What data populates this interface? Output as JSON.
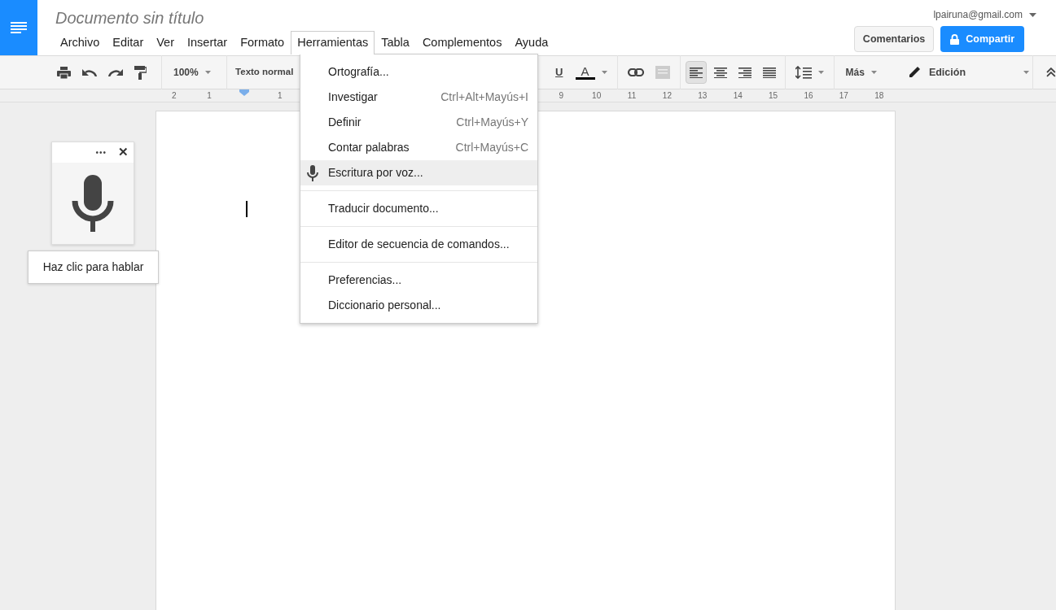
{
  "document": {
    "title": "Documento sin título"
  },
  "account": {
    "email": "lpairuna@gmail.com"
  },
  "menubar": [
    {
      "label": "Archivo",
      "selected": false
    },
    {
      "label": "Editar",
      "selected": false
    },
    {
      "label": "Ver",
      "selected": false
    },
    {
      "label": "Insertar",
      "selected": false
    },
    {
      "label": "Formato",
      "selected": false
    },
    {
      "label": "Herramientas",
      "selected": true
    },
    {
      "label": "Tabla",
      "selected": false
    },
    {
      "label": "Complementos",
      "selected": false
    },
    {
      "label": "Ayuda",
      "selected": false
    }
  ],
  "header_buttons": {
    "comments": "Comentarios",
    "share": "Compartir"
  },
  "toolbar": {
    "zoom": "100%",
    "style": "Texto normal",
    "more": "Más",
    "mode": "Edición",
    "underline": "U",
    "text_color_letter": "A",
    "alignments": [
      {
        "kind": "left",
        "selected": true
      },
      {
        "kind": "center",
        "selected": false
      },
      {
        "kind": "right",
        "selected": false
      },
      {
        "kind": "justify",
        "selected": false
      }
    ]
  },
  "ruler": {
    "left_labels": [
      "2",
      "1",
      "1"
    ],
    "right_labels": [
      "9",
      "10",
      "11",
      "12",
      "13",
      "14",
      "15",
      "16",
      "17",
      "18"
    ]
  },
  "tools_menu": {
    "groups": [
      [
        {
          "kind": "plain",
          "label": "Ortografía...",
          "selected": false
        },
        {
          "kind": "plain",
          "label": "Investigar",
          "shortcut": "Ctrl+Alt+Mayús+I",
          "selected": false
        },
        {
          "kind": "plain",
          "label": "Definir",
          "shortcut": "Ctrl+Mayús+Y",
          "selected": false
        },
        {
          "kind": "plain",
          "label": "Contar palabras",
          "shortcut": "Ctrl+Mayús+C",
          "selected": false
        },
        {
          "kind": "voice",
          "label": "Escritura por voz...",
          "selected": true
        }
      ],
      [
        {
          "kind": "plain",
          "label": "Traducir documento...",
          "selected": false
        }
      ],
      [
        {
          "kind": "plain",
          "label": "Editor de secuencia de comandos...",
          "selected": false
        }
      ],
      [
        {
          "kind": "plain",
          "label": "Preferencias...",
          "selected": false
        },
        {
          "kind": "plain",
          "label": "Diccionario personal...",
          "selected": false
        }
      ]
    ]
  },
  "voice_widget": {
    "dots": "•••",
    "close": "✕",
    "tooltip": "Haz clic para hablar"
  }
}
